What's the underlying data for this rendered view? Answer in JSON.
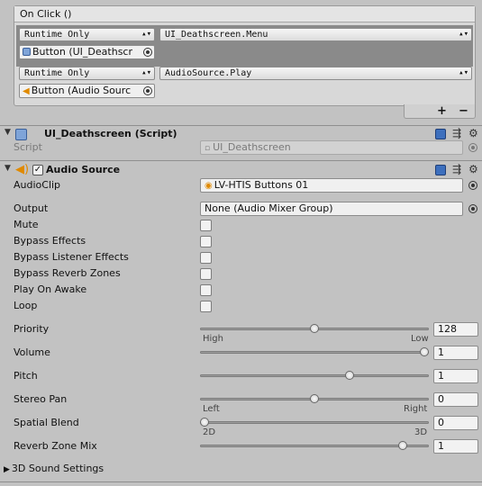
{
  "onclick": {
    "title": "On Click ()",
    "entries": [
      {
        "mode": "Runtime Only",
        "function": "UI_Deathscreen.Menu",
        "object": "Button (UI_Deathscr"
      },
      {
        "mode": "Runtime Only",
        "function": "AudioSource.Play",
        "object": "Button (Audio Sourc"
      }
    ],
    "plus": "+",
    "minus": "−"
  },
  "script_component": {
    "title": "UI_Deathscreen (Script)",
    "script_label": "Script",
    "script_value": "UI_Deathscreen"
  },
  "audio_source": {
    "title": "Audio Source",
    "enabled": true,
    "audioclip_label": "AudioClip",
    "audioclip_value": "LV-HTIS Buttons 01",
    "output_label": "Output",
    "output_value": "None (Audio Mixer Group)",
    "checkboxes": [
      {
        "label": "Mute",
        "checked": false
      },
      {
        "label": "Bypass Effects",
        "checked": false
      },
      {
        "label": "Bypass Listener Effects",
        "checked": false
      },
      {
        "label": "Bypass Reverb Zones",
        "checked": false
      },
      {
        "label": "Play On Awake",
        "checked": false
      },
      {
        "label": "Loop",
        "checked": false
      }
    ],
    "sliders": [
      {
        "label": "Priority",
        "value": "128",
        "fraction": 0.5,
        "min_label": "High",
        "max_label": "Low"
      },
      {
        "label": "Volume",
        "value": "1",
        "fraction": 1.0
      },
      {
        "label": "Pitch",
        "value": "1",
        "fraction": 0.66
      },
      {
        "label": "Stereo Pan",
        "value": "0",
        "fraction": 0.5,
        "min_label": "Left",
        "max_label": "Right"
      },
      {
        "label": "Spatial Blend",
        "value": "0",
        "fraction": 0.0,
        "min_label": "2D",
        "max_label": "3D"
      },
      {
        "label": "Reverb Zone Mix",
        "value": "1",
        "fraction": 0.9
      }
    ],
    "sound3d_label": "3D Sound Settings"
  },
  "colors": {
    "accent": "#3d6fbd",
    "panel": "#c2c2c2"
  }
}
